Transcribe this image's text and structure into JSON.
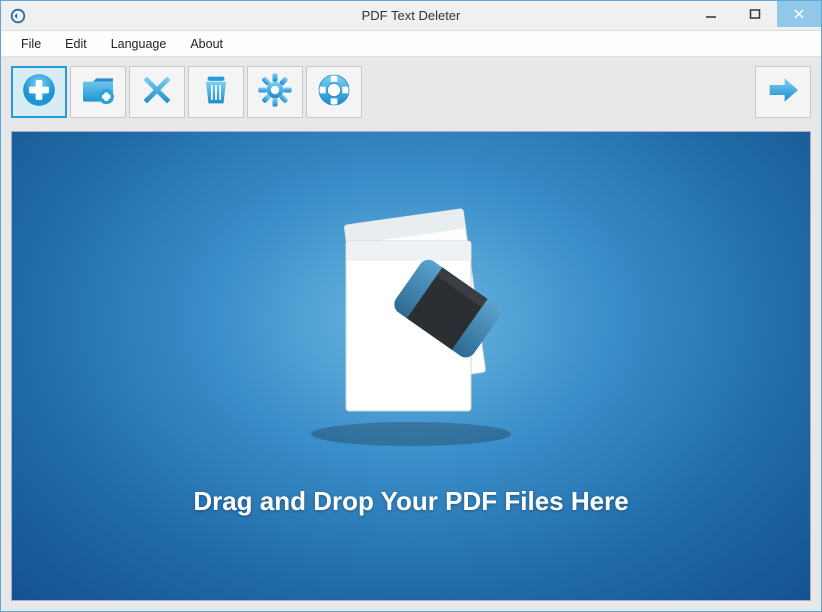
{
  "window": {
    "title": "PDF Text Deleter"
  },
  "menu": {
    "file": "File",
    "edit": "Edit",
    "language": "Language",
    "about": "About"
  },
  "toolbar": {
    "add_file": "add-file",
    "add_folder": "add-folder",
    "remove": "remove",
    "clear": "clear",
    "settings": "settings",
    "help": "help",
    "start": "start"
  },
  "dropArea": {
    "text": "Drag and Drop Your PDF Files Here"
  },
  "colors": {
    "accent": "#39a6dd",
    "close_bg": "#8fc8e8"
  }
}
